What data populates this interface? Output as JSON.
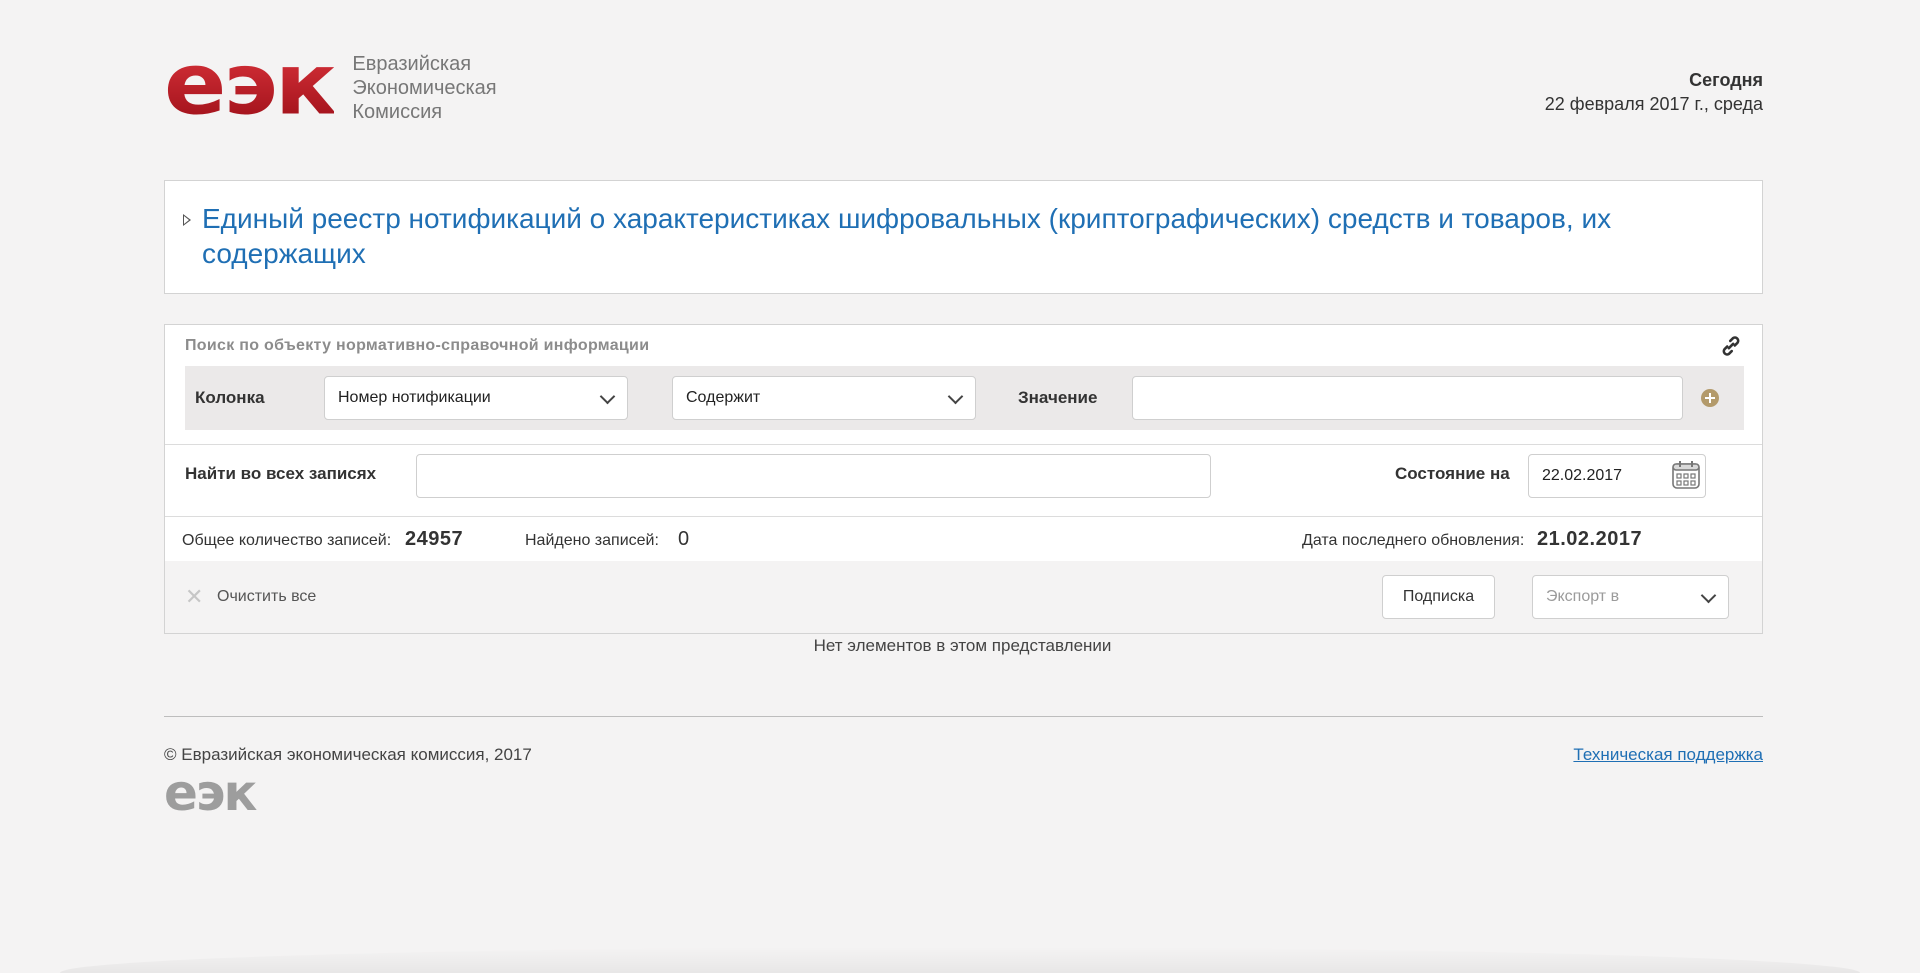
{
  "header": {
    "logo_mark": "еэк",
    "logo_lines": [
      "Евразийская",
      "Экономическая",
      "Комиссия"
    ],
    "today_label": "Сегодня",
    "today_value": "22 февраля 2017 г., среда"
  },
  "title": "Единый реестр нотификаций о характеристиках шифровальных (криптографических) средств и товаров, их содержащих",
  "search": {
    "heading": "Поиск по объекту нормативно-справочной информации",
    "column_label": "Колонка",
    "column_value": "Номер нотификации",
    "condition_value": "Содержит",
    "value_label": "Значение",
    "value_input": "",
    "find_all_label": "Найти во всех записях",
    "find_all_input": "",
    "state_label": "Состояние на",
    "state_date": "22.02.2017"
  },
  "stats": {
    "total_label": "Общее количество записей:",
    "total_value": "24957",
    "found_label": "Найдено записей:",
    "found_value": "0",
    "updated_label": "Дата последнего обновления:",
    "updated_value": "21.02.2017"
  },
  "actions": {
    "clear_label": "Очистить все",
    "subscribe_label": "Подписка",
    "export_label": "Экспорт в"
  },
  "empty_message": "Нет элементов в этом представлении",
  "footer": {
    "copyright": "© Евразийская экономическая комиссия, 2017",
    "logo_mark": "еэк",
    "support_link": "Техническая поддержка"
  },
  "colors": {
    "brand_red": "#b51c25",
    "link_blue": "#1f6fb4",
    "add_icon": "#b39a6b",
    "background": "#f4f3f3"
  }
}
